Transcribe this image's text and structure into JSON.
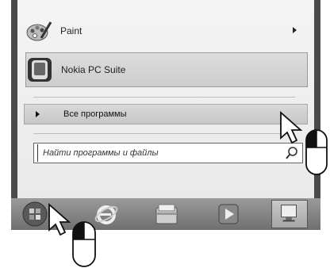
{
  "start_menu": {
    "items": [
      {
        "label": "Paint",
        "icon": "paint-palette-icon",
        "has_submenu": true
      },
      {
        "label": "Nokia PC Suite",
        "icon": "nokia-pc-suite-icon",
        "has_submenu": false
      }
    ],
    "all_programs": {
      "label": "Все программы",
      "icon": "right-triangle-icon"
    },
    "search": {
      "placeholder": "Найти программы и файлы",
      "icon": "magnifier-icon"
    }
  },
  "taskbar": {
    "buttons": [
      {
        "name": "start-orb",
        "icon": "windows-orb-icon"
      },
      {
        "name": "internet-explorer",
        "icon": "internet-explorer-icon"
      },
      {
        "name": "windows-explorer",
        "icon": "folder-icon"
      },
      {
        "name": "media-player",
        "icon": "media-player-icon"
      },
      {
        "name": "show-desktop",
        "icon": "desktop-icon"
      }
    ]
  },
  "annotations": {
    "cursors": [
      "arrow-cursor-icon",
      "arrow-cursor-icon"
    ],
    "mice": [
      "left-click-mouse-icon",
      "left-click-mouse-icon"
    ]
  }
}
